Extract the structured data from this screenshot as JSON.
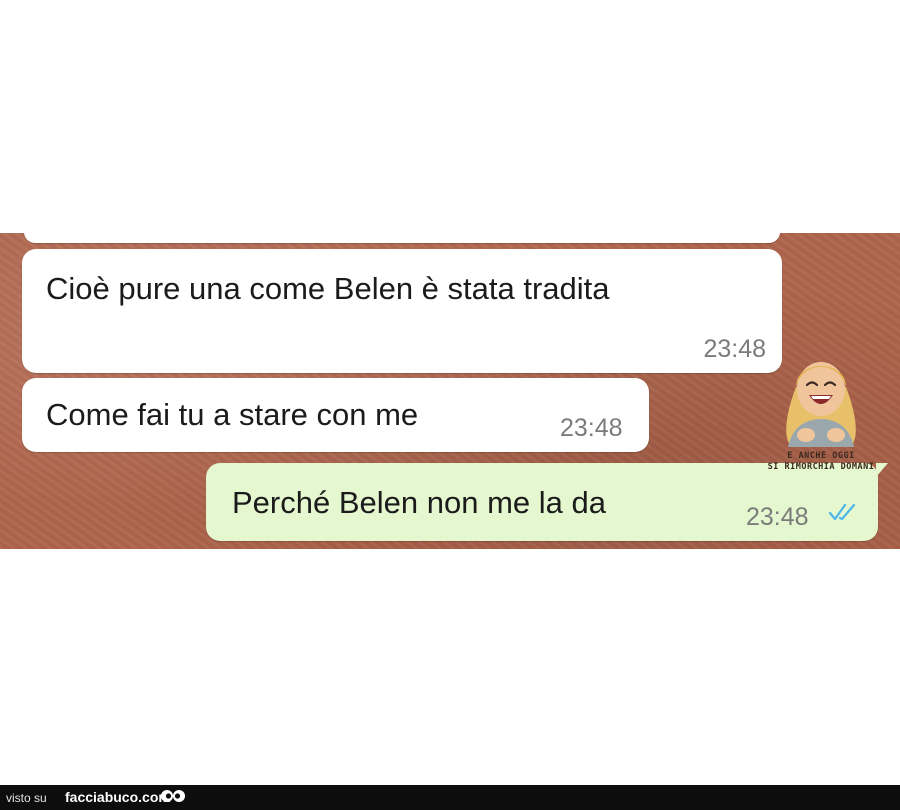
{
  "messages": [
    {
      "text": "Cioè pure una come Belen è stata tradita",
      "time": "23:48",
      "direction": "incoming"
    },
    {
      "text": "Come fai tu a stare con me",
      "time": "23:48",
      "direction": "incoming"
    },
    {
      "text": "Perché Belen non me la da",
      "time": "23:48",
      "direction": "outgoing",
      "status": "read"
    }
  ],
  "sticker": {
    "caption_line1": "E ANCHE OGGI",
    "caption_line2": "SI RIMORCHIA DOMANI",
    "icon": "laughing-woman-sticker"
  },
  "footer": {
    "prefix": "visto su",
    "site": "facciabuco.com",
    "icon": "eyes-logo-icon"
  },
  "colors": {
    "wallpaper": "#b0654c",
    "incoming_bubble": "#ffffff",
    "outgoing_bubble": "#e4f7cf",
    "read_ticks": "#4fb6ec",
    "footer_bg": "#0d0d0d"
  }
}
